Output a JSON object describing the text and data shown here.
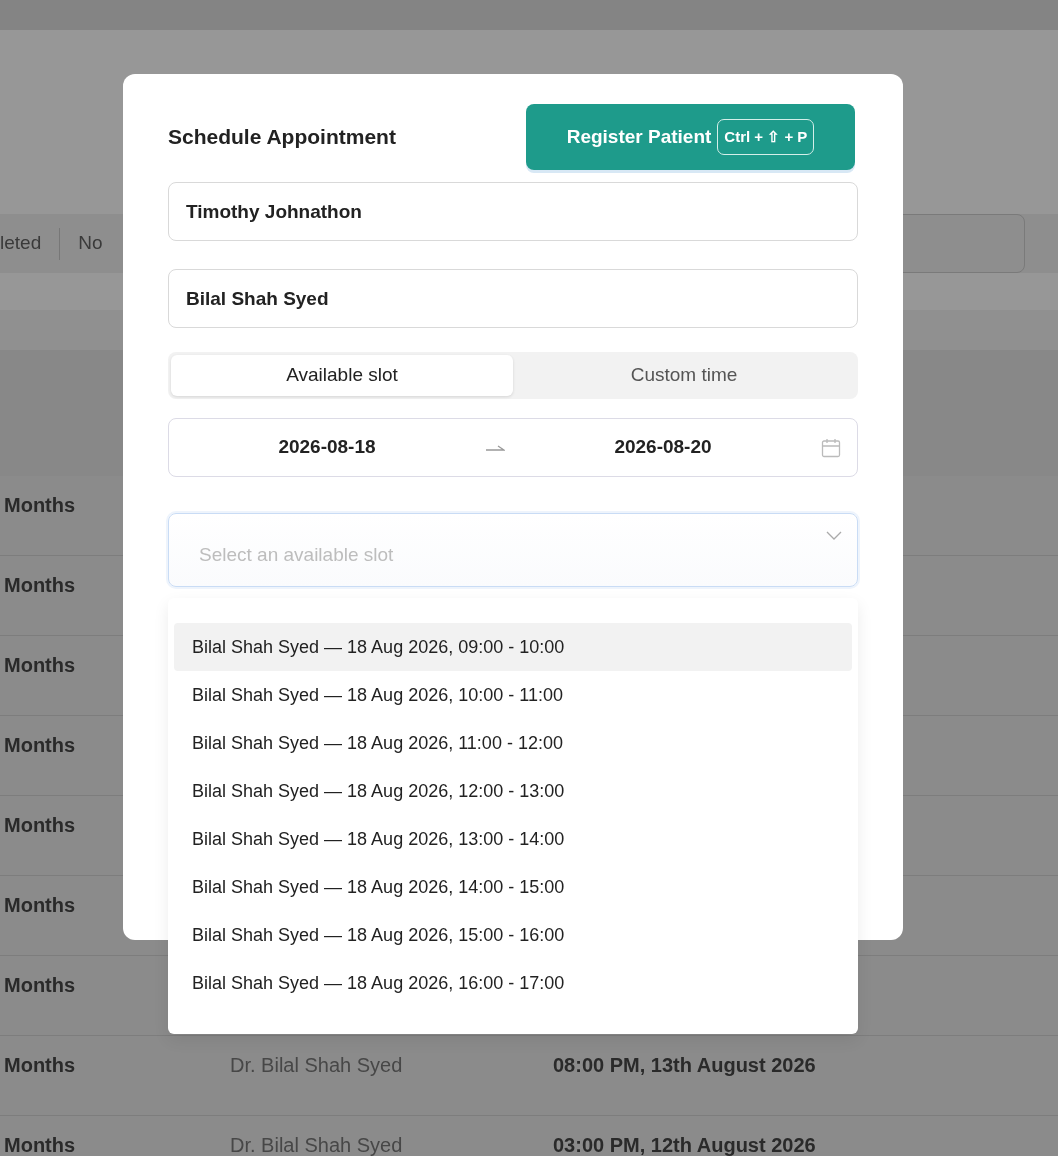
{
  "background": {
    "filter_tabs": [
      "leted",
      "No"
    ],
    "table_rows": [
      {
        "duration": "Months"
      },
      {
        "duration": "Months"
      },
      {
        "duration": "Months"
      },
      {
        "duration": "Months"
      },
      {
        "duration": "Months"
      },
      {
        "duration": "Months"
      },
      {
        "duration": "Months"
      },
      {
        "duration": "Months",
        "doctor": "Dr. Bilal Shah Syed",
        "datetime": "08:00 PM, 13th August 2026"
      },
      {
        "duration": "Months",
        "doctor": "Dr. Bilal Shah Syed",
        "datetime": "03:00 PM, 12th August 2026"
      }
    ]
  },
  "modal": {
    "title": "Schedule Appointment",
    "register_button": {
      "label": "Register Patient",
      "shortcut": "Ctrl + ⇧ + P"
    },
    "patient_field": {
      "value": "Timothy Johnathon"
    },
    "doctor_field": {
      "value": "Bilal Shah Syed"
    },
    "mode_tabs": [
      {
        "label": "Available slot",
        "selected": true
      },
      {
        "label": "Custom time",
        "selected": false
      }
    ],
    "date_range": {
      "start": "2026-08-18",
      "end": "2026-08-20"
    },
    "slot_select": {
      "placeholder": "Select an available slot",
      "expanded": true
    },
    "slot_options": [
      {
        "label": "Bilal Shah Syed — 18 Aug 2026, 09:00 - 10:00",
        "active": true
      },
      {
        "label": "Bilal Shah Syed — 18 Aug 2026, 10:00 - 11:00",
        "active": false
      },
      {
        "label": "Bilal Shah Syed — 18 Aug 2026, 11:00 - 12:00",
        "active": false
      },
      {
        "label": "Bilal Shah Syed — 18 Aug 2026, 12:00 - 13:00",
        "active": false
      },
      {
        "label": "Bilal Shah Syed — 18 Aug 2026, 13:00 - 14:00",
        "active": false
      },
      {
        "label": "Bilal Shah Syed — 18 Aug 2026, 14:00 - 15:00",
        "active": false
      },
      {
        "label": "Bilal Shah Syed — 18 Aug 2026, 15:00 - 16:00",
        "active": false
      },
      {
        "label": "Bilal Shah Syed — 18 Aug 2026, 16:00 - 17:00",
        "active": false
      }
    ]
  }
}
